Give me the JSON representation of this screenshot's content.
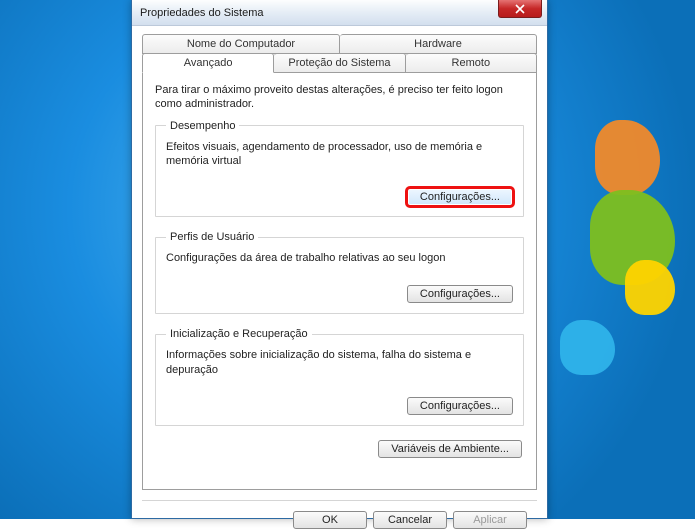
{
  "window": {
    "title": "Propriedades do Sistema"
  },
  "tabs": {
    "back": [
      {
        "label": "Nome do Computador"
      },
      {
        "label": "Hardware"
      }
    ],
    "front": [
      {
        "label": "Avançado"
      },
      {
        "label": "Proteção do Sistema"
      },
      {
        "label": "Remoto"
      }
    ]
  },
  "advanced": {
    "intro": "Para tirar o máximo proveito destas alterações, é preciso ter feito logon como administrador.",
    "performance": {
      "legend": "Desempenho",
      "desc": "Efeitos visuais, agendamento de processador, uso de memória e memória virtual",
      "button": "Configurações..."
    },
    "profiles": {
      "legend": "Perfis de Usuário",
      "desc": "Configurações da área de trabalho relativas ao seu logon",
      "button": "Configurações..."
    },
    "startup": {
      "legend": "Inicialização e Recuperação",
      "desc": "Informações sobre inicialização do sistema, falha do sistema e depuração",
      "button": "Configurações..."
    },
    "env_button": "Variáveis de Ambiente..."
  },
  "dialog": {
    "ok": "OK",
    "cancel": "Cancelar",
    "apply": "Aplicar"
  }
}
